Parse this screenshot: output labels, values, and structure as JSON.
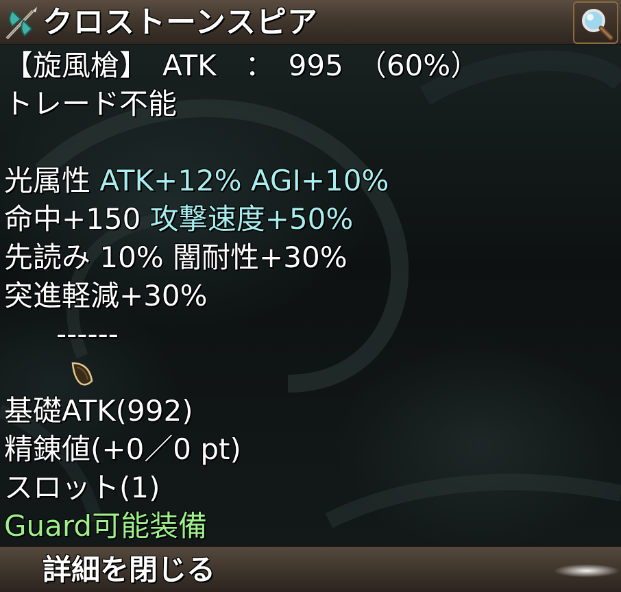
{
  "item": {
    "name": "クロストーンスピア",
    "icon": "axe-spear-icon"
  },
  "toolbar": {
    "search_icon": "magnifier-icon"
  },
  "details": {
    "header_line": "【旋風槍】　ATK　：　995　（60%）",
    "trade_status": "トレード不能",
    "effects": [
      {
        "white": "光属性 ",
        "cyan": "ATK+12% AGI+10%"
      },
      {
        "white": "命中+150 ",
        "cyan": "攻撃速度+50%"
      },
      {
        "white": "先読み 10% 闇耐性+30%",
        "cyan": ""
      },
      {
        "white": "突進軽減+30%",
        "cyan": ""
      }
    ],
    "card_slot_icon": "card-slot-icon",
    "card_slot_text": "------",
    "base_atk": "基礎ATK(992)",
    "refine": "精錬値(+0／0 pt)",
    "slots": "スロット(1)",
    "guard": "Guard可能装備"
  },
  "footer": {
    "close_label": "詳細を閉じる"
  },
  "colors": {
    "text": "#ffffff",
    "cyan": "#a9eef0",
    "green": "#9df08a",
    "bar": "#4a3e33"
  }
}
